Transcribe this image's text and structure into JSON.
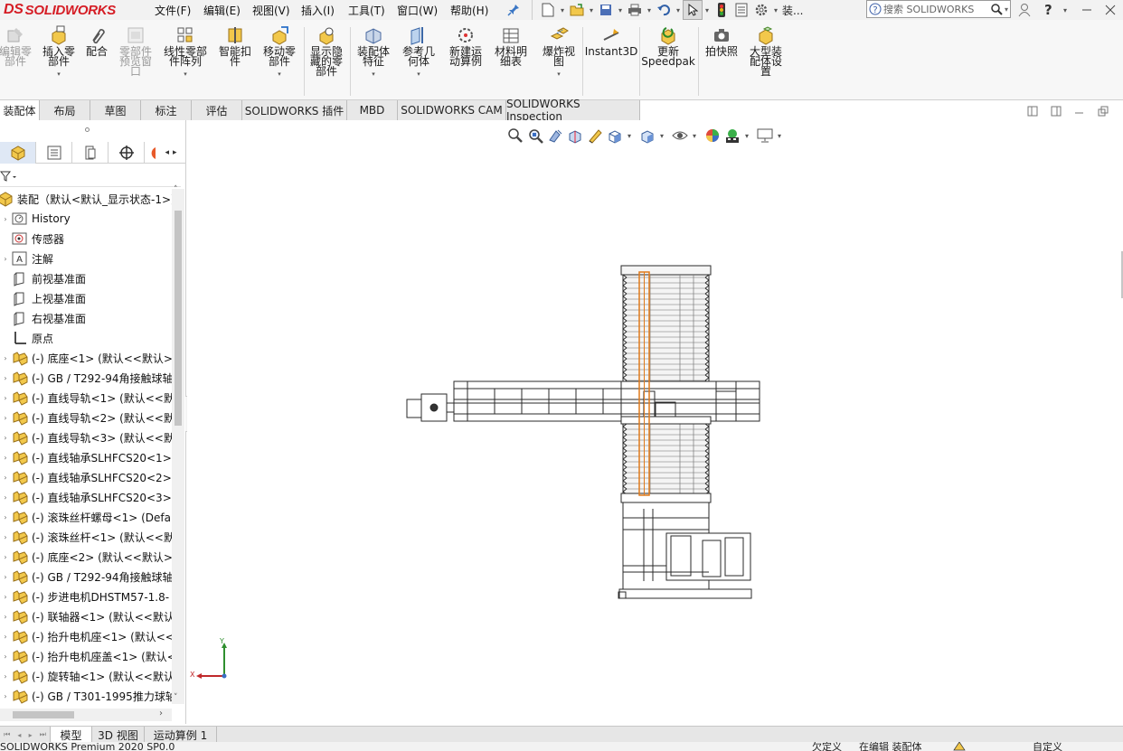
{
  "app": {
    "brand": "SOLIDWORKS",
    "brand_mark": "DS"
  },
  "menu": [
    {
      "label": "文件(F)"
    },
    {
      "label": "编辑(E)"
    },
    {
      "label": "视图(V)"
    },
    {
      "label": "插入(I)"
    },
    {
      "label": "工具(T)"
    },
    {
      "label": "窗口(W)"
    },
    {
      "label": "帮助(H)"
    }
  ],
  "search": {
    "placeholder": "搜索 SOLIDWORKS"
  },
  "quick": {
    "truncated": "装..."
  },
  "ribbon": [
    {
      "label": "编辑零\n部件",
      "enabled": false
    },
    {
      "label": "插入零\n部件",
      "enabled": true
    },
    {
      "label": "配合",
      "enabled": true
    },
    {
      "label": "零部件\n预览窗\n口",
      "enabled": false
    },
    {
      "label": "线性零部\n件阵列",
      "enabled": true
    },
    {
      "label": "智能扣\n件",
      "enabled": true
    },
    {
      "label": "移动零\n部件",
      "enabled": true
    },
    {
      "label": "显示隐\n藏的零\n部件",
      "enabled": true
    },
    {
      "label": "装配体\n特征",
      "enabled": true
    },
    {
      "label": "参考几\n何体",
      "enabled": true
    },
    {
      "label": "新建运\n动算例",
      "enabled": true
    },
    {
      "label": "材料明\n细表",
      "enabled": true
    },
    {
      "label": "爆炸视\n图",
      "enabled": true
    },
    {
      "label": "Instant3D",
      "enabled": true
    },
    {
      "label": "更新\nSpeedpak",
      "enabled": true
    },
    {
      "label": "拍快照",
      "enabled": true
    },
    {
      "label": "大型装\n配体设\n置",
      "enabled": true
    }
  ],
  "tabs": [
    {
      "label": "装配体",
      "active": true
    },
    {
      "label": "布局"
    },
    {
      "label": "草图"
    },
    {
      "label": "标注"
    },
    {
      "label": "评估"
    },
    {
      "label": "SOLIDWORKS 插件"
    },
    {
      "label": "MBD"
    },
    {
      "label": "SOLIDWORKS CAM"
    },
    {
      "label": "SOLIDWORKS Inspection"
    }
  ],
  "tree": {
    "root": "装配（默认<默认_显示状态-1>）",
    "items": [
      {
        "label": "History",
        "icon": "history-icon"
      },
      {
        "label": "传感器",
        "icon": "sensor-icon"
      },
      {
        "label": "注解",
        "icon": "annotation-icon"
      },
      {
        "label": "前视基准面",
        "icon": "plane-icon"
      },
      {
        "label": "上视基准面",
        "icon": "plane-icon"
      },
      {
        "label": "右视基准面",
        "icon": "plane-icon"
      },
      {
        "label": "原点",
        "icon": "origin-icon"
      },
      {
        "label": "(-) 底座<1> (默认<<默认>_",
        "icon": "part-icon"
      },
      {
        "label": "(-) GB / T292-94角接触球轴",
        "icon": "part-icon"
      },
      {
        "label": "(-) 直线导轨<1> (默认<<默",
        "icon": "part-icon"
      },
      {
        "label": "(-) 直线导轨<2> (默认<<默",
        "icon": "part-icon"
      },
      {
        "label": "(-) 直线导轨<3> (默认<<默",
        "icon": "part-icon"
      },
      {
        "label": "(-) 直线轴承SLHFCS20<1>",
        "icon": "part-icon"
      },
      {
        "label": "(-) 直线轴承SLHFCS20<2>",
        "icon": "part-icon"
      },
      {
        "label": "(-) 直线轴承SLHFCS20<3>",
        "icon": "part-icon"
      },
      {
        "label": "(-) 滚珠丝杆螺母<1> (Defa",
        "icon": "part-icon"
      },
      {
        "label": "(-) 滚珠丝杆<1> (默认<<默",
        "icon": "part-icon"
      },
      {
        "label": "(-) 底座<2> (默认<<默认>_",
        "icon": "part-icon"
      },
      {
        "label": "(-) GB / T292-94角接触球轴",
        "icon": "part-icon"
      },
      {
        "label": "(-) 步进电机DHSTM57-1.8-",
        "icon": "part-icon"
      },
      {
        "label": "(-) 联轴器<1> (默认<<默认",
        "icon": "part-icon"
      },
      {
        "label": "(-) 抬升电机座<1> (默认<<",
        "icon": "part-icon"
      },
      {
        "label": "(-) 抬升电机座盖<1> (默认<",
        "icon": "part-icon"
      },
      {
        "label": "(-) 旋转轴<1> (默认<<默认",
        "icon": "part-icon"
      },
      {
        "label": "(-) GB / T301-1995推力球轴",
        "icon": "part-icon"
      }
    ]
  },
  "bottom_tabs": [
    {
      "label": "模型",
      "active": true
    },
    {
      "label": "3D 视图"
    },
    {
      "label": "运动算例 1"
    }
  ],
  "status": {
    "left": "SOLIDWORKS Premium 2020 SP0.0",
    "mid1": "欠定义",
    "mid2": "在编辑 装配体",
    "right": "自定义"
  },
  "triad": {
    "x": "X",
    "y": "Y"
  },
  "colors": {
    "accent": "#d51c24",
    "highlight": "#e07a1a",
    "tab_bg": "#e8e8e8"
  }
}
